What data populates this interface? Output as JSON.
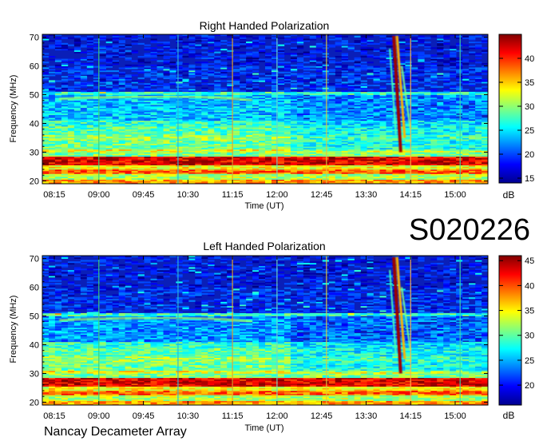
{
  "observation_id": "S020226",
  "instrument": "Nancay Decameter Array",
  "chart_data": [
    {
      "type": "heatmap",
      "title": "Right Handed Polarization",
      "xlabel": "Time (UT)",
      "ylabel": "Frequency (MHz)",
      "x_ticks": [
        "08:15",
        "09:00",
        "09:45",
        "10:30",
        "11:15",
        "12:00",
        "12:45",
        "13:30",
        "14:15",
        "15:00"
      ],
      "y_ticks": [
        20,
        30,
        40,
        50,
        60,
        70
      ],
      "ylim": [
        19,
        71
      ],
      "colorbar": {
        "label": "dB",
        "ticks": [
          15,
          20,
          25,
          30,
          35,
          40
        ],
        "range": [
          14,
          45
        ]
      },
      "features": [
        {
          "label": "vertical markers at",
          "values": [
            "09:00",
            "10:20",
            "11:15",
            "12:00",
            "12:50",
            "14:15",
            "15:05"
          ]
        },
        {
          "label": "strong burst",
          "values": [
            "13:55–14:10",
            "30–70 MHz"
          ]
        }
      ]
    },
    {
      "type": "heatmap",
      "title": "Left Handed Polarization",
      "xlabel": "Time (UT)",
      "ylabel": "Frequency (MHz)",
      "x_ticks": [
        "08:15",
        "09:00",
        "09:45",
        "10:30",
        "11:15",
        "12:00",
        "12:45",
        "13:30",
        "14:15",
        "15:00"
      ],
      "y_ticks": [
        20,
        30,
        40,
        50,
        60,
        70
      ],
      "ylim": [
        19,
        71
      ],
      "colorbar": {
        "label": "dB",
        "ticks": [
          20,
          25,
          30,
          35,
          40,
          45
        ],
        "range": [
          16,
          46
        ]
      },
      "features": [
        {
          "label": "vertical markers at",
          "values": [
            "09:00",
            "10:20",
            "11:15",
            "12:00",
            "12:50",
            "14:15",
            "15:05"
          ]
        },
        {
          "label": "strong burst",
          "values": [
            "13:55–14:10",
            "30–70 MHz"
          ]
        }
      ]
    }
  ]
}
